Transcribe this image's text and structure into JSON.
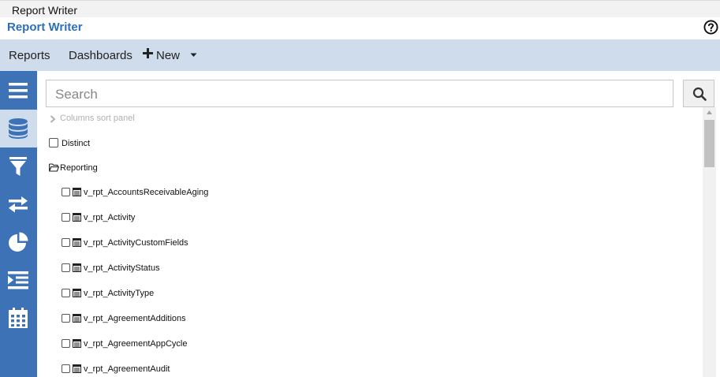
{
  "window": {
    "title": "Report Writer"
  },
  "header": {
    "app_title": "Report Writer",
    "help_icon": "question-circle-icon"
  },
  "menubar": {
    "reports_label": "Reports",
    "dashboards_label": "Dashboards",
    "new_label": "New",
    "new_icon": "plus-icon",
    "dropdown_icon": "caret-down-icon"
  },
  "sidebar": {
    "items": [
      {
        "icon": "hamburger-menu-icon",
        "active": false
      },
      {
        "icon": "database-icon",
        "active": true
      },
      {
        "icon": "filter-icon",
        "active": false
      },
      {
        "icon": "swap-arrows-icon",
        "active": false
      },
      {
        "icon": "pie-chart-icon",
        "active": false
      },
      {
        "icon": "indent-list-icon",
        "active": false
      },
      {
        "icon": "calendar-icon",
        "active": false
      }
    ],
    "colors": {
      "background": "#3d73b6",
      "active": "#cfdcec"
    }
  },
  "search": {
    "placeholder": "Search",
    "button_icon": "search-icon"
  },
  "sort_panel": {
    "label": "Columns sort panel"
  },
  "distinct": {
    "label": "Distinct",
    "checked": false
  },
  "folder": {
    "label": "Reporting",
    "icon": "folder-open-icon"
  },
  "tables": [
    {
      "name": "v_rpt_AccountsReceivableAging"
    },
    {
      "name": "v_rpt_Activity"
    },
    {
      "name": "v_rpt_ActivityCustomFields"
    },
    {
      "name": "v_rpt_ActivityStatus"
    },
    {
      "name": "v_rpt_ActivityType"
    },
    {
      "name": "v_rpt_AgreementAdditions"
    },
    {
      "name": "v_rpt_AgreementAppCycle"
    },
    {
      "name": "v_rpt_AgreementAudit"
    }
  ],
  "colors": {
    "title_blue": "#2c6fbb",
    "menubar_bg": "#cfdcec"
  }
}
